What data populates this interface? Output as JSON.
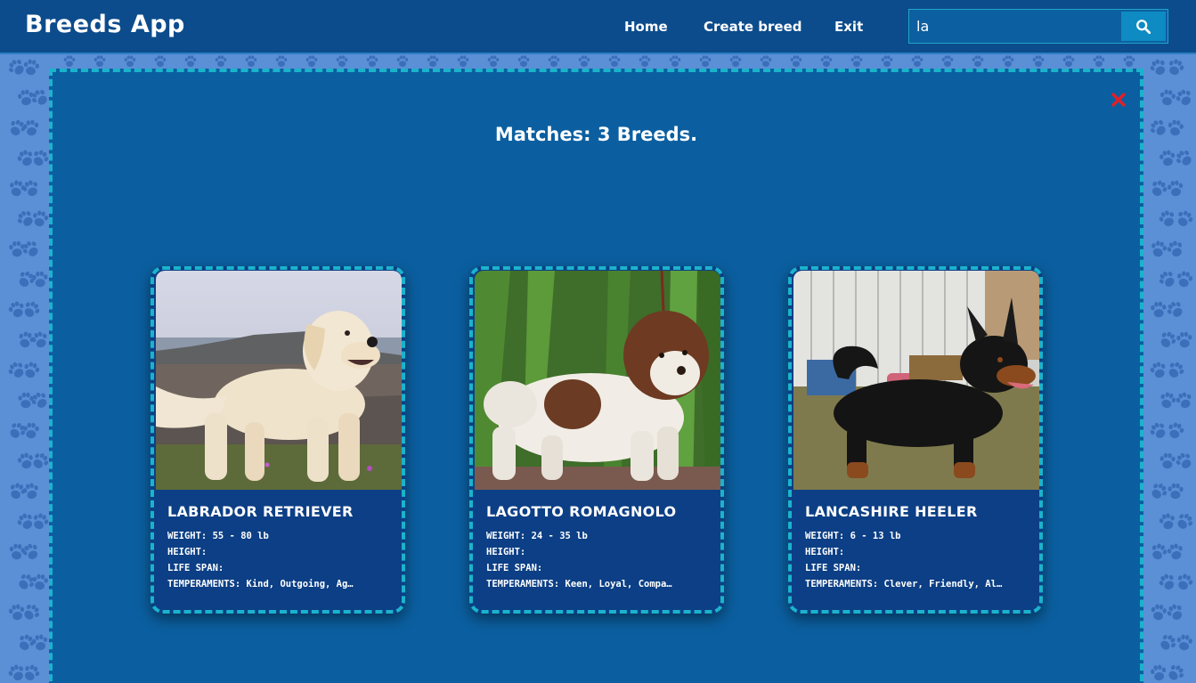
{
  "navbar": {
    "brand": "Breeds App",
    "links": [
      "Home",
      "Create breed",
      "Exit"
    ],
    "search": {
      "value": "la",
      "icon": "search-icon"
    }
  },
  "panel": {
    "close_icon": "close-icon",
    "close_color": "#e0202a",
    "matches_label": "Matches:",
    "matches_count": "3",
    "matches_suffix": "Breeds."
  },
  "cards": [
    {
      "name": "LABRADOR RETRIEVER",
      "weight_label": "WEIGHT:",
      "weight": "55 - 80 lb",
      "height_label": "HEIGHT:",
      "life_label": "LIFE SPAN:",
      "temp_label": "TEMPERAMENTS:",
      "temperaments": "Kind, Outgoing, Ag…"
    },
    {
      "name": "LAGOTTO ROMAGNOLO",
      "weight_label": "WEIGHT:",
      "weight": "24 - 35 lb",
      "height_label": "HEIGHT:",
      "life_label": "LIFE SPAN:",
      "temp_label": "TEMPERAMENTS:",
      "temperaments": "Keen, Loyal, Compa…"
    },
    {
      "name": "LANCASHIRE HEELER",
      "weight_label": "WEIGHT:",
      "weight": "6 - 13 lb",
      "height_label": "HEIGHT:",
      "life_label": "LIFE SPAN:",
      "temp_label": "TEMPERAMENTS:",
      "temperaments": "Clever, Friendly, Al…"
    }
  ],
  "colors": {
    "navbar": "#0c4c8c",
    "panel": "#0b5fa0",
    "dashed_border": "#1bb3cc",
    "card": "#0c3f85",
    "page_background": "#5b8fd6",
    "paw": "#3c6fb9"
  }
}
